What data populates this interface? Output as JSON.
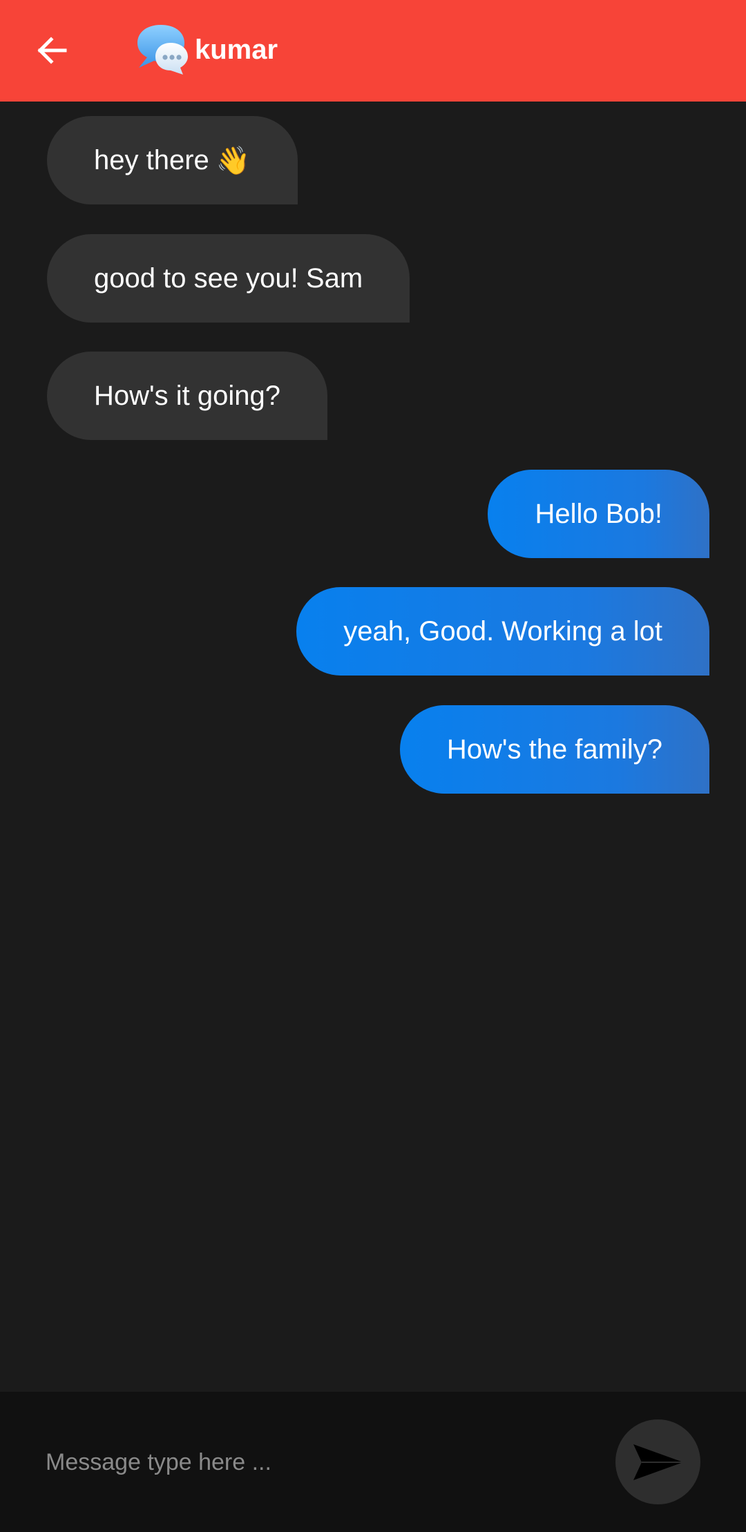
{
  "header": {
    "back_icon": "arrow-left-icon",
    "logo_icon": "chat-bubbles-icon",
    "title": "kumar",
    "background": "#f74438"
  },
  "messages": [
    {
      "direction": "incoming",
      "text": "hey there",
      "emoji": "👋"
    },
    {
      "direction": "incoming",
      "text": "good to see you! Sam"
    },
    {
      "direction": "incoming",
      "text": "How's it going?"
    },
    {
      "direction": "outgoing",
      "text": "Hello Bob!"
    },
    {
      "direction": "outgoing",
      "text": "yeah, Good. Working a lot"
    },
    {
      "direction": "outgoing",
      "text": "How's the family?"
    }
  ],
  "composer": {
    "placeholder": "Message type here ...",
    "value": "",
    "send_icon": "send-icon"
  },
  "colors": {
    "background": "#1b1b1b",
    "incoming_bubble": "#323232",
    "outgoing_bubble": "#0880ee",
    "composer_bg": "#111111"
  }
}
